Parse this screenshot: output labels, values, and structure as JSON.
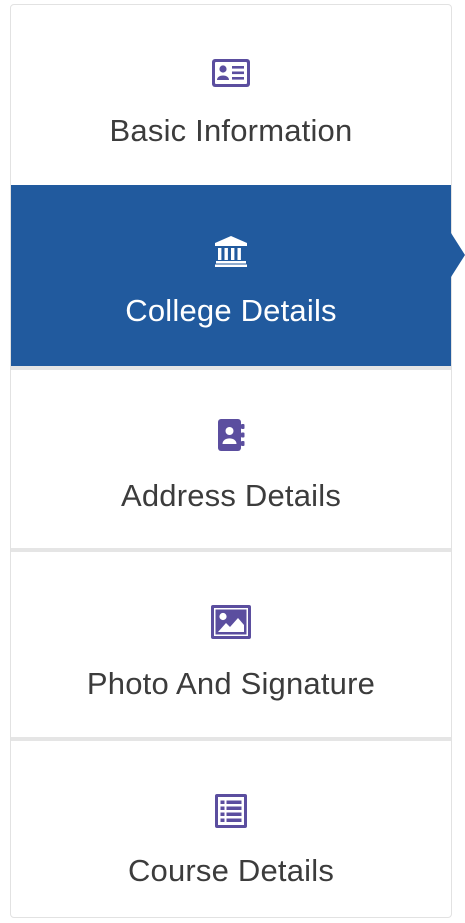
{
  "steps": [
    {
      "label": "Basic Information",
      "icon": "id-card-icon",
      "active": false
    },
    {
      "label": "College Details",
      "icon": "university-icon",
      "active": true
    },
    {
      "label": "Address Details",
      "icon": "address-book-icon",
      "active": false
    },
    {
      "label": "Photo And Signature",
      "icon": "image-icon",
      "active": false
    },
    {
      "label": "Course Details",
      "icon": "list-icon",
      "active": false
    }
  ],
  "colors": {
    "active_background": "#215a9e",
    "icon": "#5b4e9f",
    "label": "#3c3c3c",
    "active_label": "#ffffff"
  }
}
